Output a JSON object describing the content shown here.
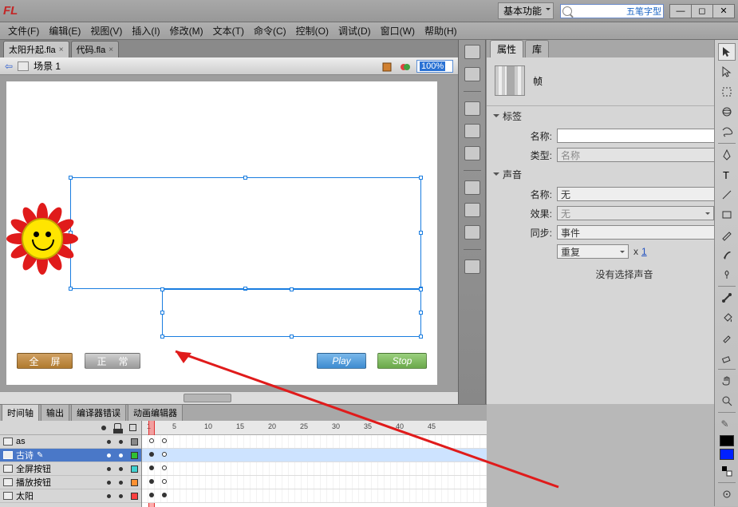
{
  "titlebar": {
    "logo": "FL",
    "workspace": "基本功能",
    "ime": "五笔字型"
  },
  "menu": [
    "文件(F)",
    "编辑(E)",
    "视图(V)",
    "插入(I)",
    "修改(M)",
    "文本(T)",
    "命令(C)",
    "控制(O)",
    "调试(D)",
    "窗口(W)",
    "帮助(H)"
  ],
  "doctabs": [
    {
      "label": "太阳升起.fla",
      "active": true
    },
    {
      "label": "代码.fla",
      "active": false
    }
  ],
  "scene": {
    "label": "场景 1",
    "zoom": "100%"
  },
  "stage_buttons": {
    "full": "全 屏",
    "normal": "正 常",
    "play": "Play",
    "stop": "Stop"
  },
  "prop": {
    "tabs": [
      "属性",
      "库"
    ],
    "header_label": "帧",
    "section_label": "标签",
    "name_label": "名称:",
    "type_label": "类型:",
    "type_value": "名称",
    "section_sound": "声音",
    "sound_name_label": "名称:",
    "sound_name_value": "无",
    "effect_label": "效果:",
    "effect_value": "无",
    "sync_label": "同步:",
    "sync_value": "事件",
    "repeat_value": "重复",
    "x_label": "x",
    "x_value": "1",
    "nosound": "没有选择声音"
  },
  "timeline": {
    "tabs": [
      "时间轴",
      "输出",
      "编译器错误",
      "动画编辑器"
    ],
    "ruler": [
      "1",
      "5",
      "10",
      "15",
      "20",
      "25",
      "30",
      "35",
      "40",
      "45"
    ],
    "layers": [
      {
        "name": "as",
        "sq": "gray"
      },
      {
        "name": "古诗",
        "sq": "green",
        "selected": true
      },
      {
        "name": "全屏按钮",
        "sq": "cyan"
      },
      {
        "name": "播放按钮",
        "sq": "orange"
      },
      {
        "name": "太阳",
        "sq": "red"
      }
    ]
  }
}
